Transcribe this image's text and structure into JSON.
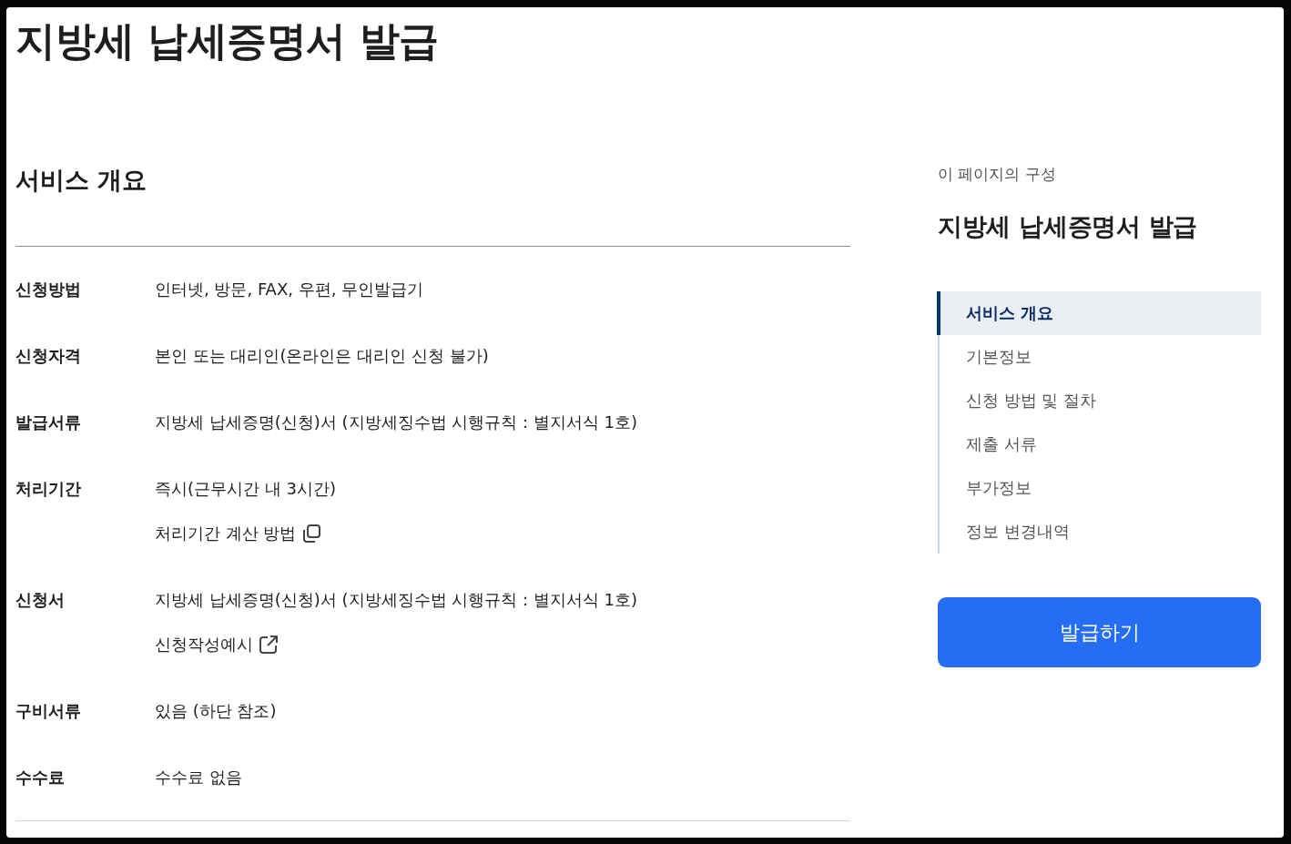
{
  "page": {
    "title": "지방세 납세증명서 발급"
  },
  "overview": {
    "heading": "서비스 개요",
    "rows": [
      {
        "label": "신청방법",
        "lines": [
          {
            "kind": "text",
            "text": "인터넷, 방문, FAX, 우편, 무인발급기"
          }
        ]
      },
      {
        "label": "신청자격",
        "lines": [
          {
            "kind": "text",
            "text": "본인 또는 대리인(온라인은 대리인 신청 불가)"
          }
        ]
      },
      {
        "label": "발급서류",
        "lines": [
          {
            "kind": "text",
            "text": "지방세 납세증명(신청)서 (지방세징수법 시행규칙 : 별지서식 1호)"
          }
        ]
      },
      {
        "label": "처리기간",
        "lines": [
          {
            "kind": "text",
            "text": "즉시(근무시간 내 3시간)"
          },
          {
            "kind": "popup_link",
            "text": "처리기간 계산 방법"
          }
        ]
      },
      {
        "label": "신청서",
        "lines": [
          {
            "kind": "text",
            "text": "지방세 납세증명(신청)서 (지방세징수법 시행규칙 : 별지서식 1호)"
          },
          {
            "kind": "external_link",
            "text": "신청작성예시"
          }
        ]
      },
      {
        "label": "구비서류",
        "lines": [
          {
            "kind": "text",
            "text": "있음 (하단 참조)"
          }
        ]
      },
      {
        "label": "수수료",
        "lines": [
          {
            "kind": "text",
            "text": "수수료 없음"
          }
        ]
      }
    ]
  },
  "toc": {
    "caption": "이 페이지의 구성",
    "title": "지방세 납세증명서 발급",
    "items": [
      {
        "label": "서비스 개요",
        "selected": true
      },
      {
        "label": "기본정보",
        "selected": false
      },
      {
        "label": "신청 방법 및 절차",
        "selected": false
      },
      {
        "label": "제출 서류",
        "selected": false
      },
      {
        "label": "부가정보",
        "selected": false
      },
      {
        "label": "정보 변경내역",
        "selected": false
      }
    ]
  },
  "action_button": {
    "label": "발급하기"
  }
}
